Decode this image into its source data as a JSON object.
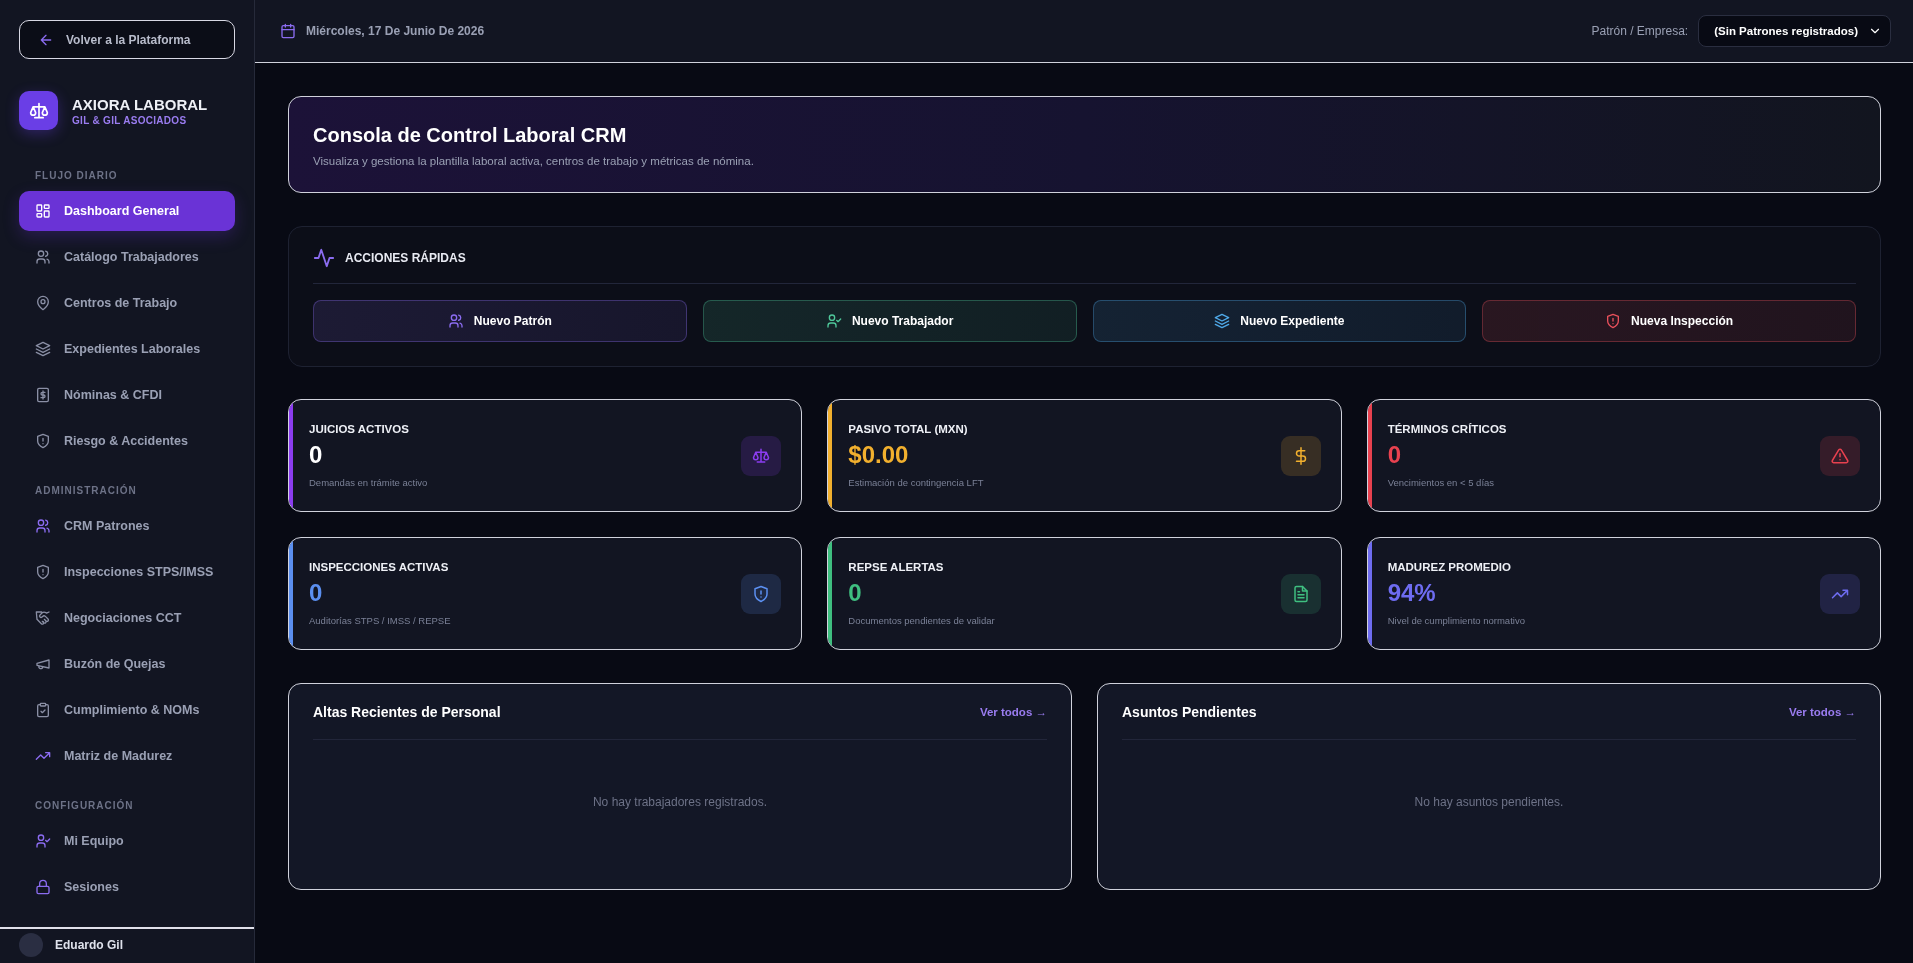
{
  "sidebar": {
    "back_button": "Volver a la Plataforma",
    "brand": {
      "title": "AXIORA LABORAL",
      "subtitle": "GIL & GIL ASOCIADOS"
    },
    "sections": [
      {
        "label": "FLUJO DIARIO",
        "items": [
          {
            "label": "Dashboard General",
            "selected": true
          },
          {
            "label": "Catálogo Trabajadores",
            "selected": false
          },
          {
            "label": "Centros de Trabajo",
            "selected": false
          },
          {
            "label": "Expedientes Laborales",
            "selected": false
          },
          {
            "label": "Nóminas & CFDI",
            "selected": false
          },
          {
            "label": "Riesgo & Accidentes",
            "selected": false
          }
        ]
      },
      {
        "label": "ADMINISTRACIÓN",
        "items": [
          {
            "label": "CRM Patrones",
            "selected": false
          },
          {
            "label": "Inspecciones STPS/IMSS",
            "selected": false
          },
          {
            "label": "Negociaciones CCT",
            "selected": false
          },
          {
            "label": "Buzón de Quejas",
            "selected": false
          },
          {
            "label": "Cumplimiento & NOMs",
            "selected": false
          },
          {
            "label": "Matriz de Madurez",
            "selected": false
          }
        ]
      },
      {
        "label": "CONFIGURACIÓN",
        "items": [
          {
            "label": "Mi Equipo",
            "selected": false
          },
          {
            "label": "Sesiones",
            "selected": false
          }
        ]
      }
    ],
    "user": {
      "name": "Eduardo Gil"
    }
  },
  "header": {
    "date": "Miércoles, 17 De Junio De 2026",
    "employer_label": "Patrón / Empresa:",
    "employer_select": "(Sin Patrones registrados)"
  },
  "hero": {
    "title": "Consola de Control Laboral CRM",
    "subtitle": "Visualiza y gestiona la plantilla laboral activa, centros de trabajo y métricas de nómina."
  },
  "quick_actions": {
    "title": "ACCIONES RÁPIDAS",
    "buttons": [
      {
        "label": "Nuevo Patrón",
        "color": "#8b6cf0"
      },
      {
        "label": "Nuevo Trabajador",
        "color": "#4fc79a"
      },
      {
        "label": "Nuevo Expediente",
        "color": "#4fa9e8"
      },
      {
        "label": "Nueva Inspección",
        "color": "#e8505b"
      }
    ]
  },
  "stats": [
    {
      "label": "JUICIOS ACTIVOS",
      "value": "0",
      "note": "Demandas en trámite activo",
      "color": "#8b3cf0"
    },
    {
      "label": "PASIVO TOTAL (MXN)",
      "value": "$0.00",
      "note": "Estimación de contingencia LFT",
      "color": "#f2b02e"
    },
    {
      "label": "TÉRMINOS CRÍTICOS",
      "value": "0",
      "note": "Vencimientos en < 5 días",
      "color": "#e8414f"
    },
    {
      "label": "INSPECCIONES ACTIVAS",
      "value": "0",
      "note": "Auditorías STPS / IMSS / REPSE",
      "color": "#5b8ff0"
    },
    {
      "label": "REPSE ALERTAS",
      "value": "0",
      "note": "Documentos pendientes de validar",
      "color": "#3fbf80"
    },
    {
      "label": "MADUREZ PROMEDIO",
      "value": "94%",
      "note": "Nivel de cumplimiento normativo",
      "color": "#6e6cf0"
    }
  ],
  "panels": [
    {
      "title": "Altas Recientes de Personal",
      "link": "Ver todos →",
      "empty": "No hay trabajadores registrados."
    },
    {
      "title": "Asuntos Pendientes",
      "link": "Ver todos →",
      "empty": "No hay asuntos pendientes."
    }
  ]
}
